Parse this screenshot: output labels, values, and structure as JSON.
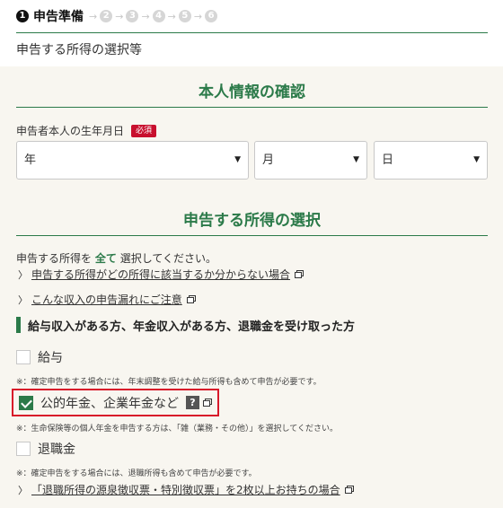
{
  "stepper": {
    "steps": [
      "1",
      "2",
      "3",
      "4",
      "5",
      "6"
    ],
    "active_label": "申告準備",
    "arrow": "→"
  },
  "subtitle": "申告する所得の選択等",
  "personal_section": {
    "heading": "本人情報の確認",
    "birth_label": "申告者本人の生年月日",
    "required_badge": "必須",
    "year_value": "年",
    "month_value": "月",
    "day_value": "日"
  },
  "income_section": {
    "heading": "申告する所得の選択",
    "intro_before": "申告する所得を",
    "intro_emphasis": "全て",
    "intro_after": "選択してください。",
    "link1": "申告する所得がどの所得に該当するか分からない場合",
    "link2": "こんな収入の申告漏れにご注意",
    "subheading": "給与収入がある方、年金収入がある方、退職金を受け取った方",
    "items": [
      {
        "label": "給与",
        "checked": false
      },
      {
        "label": "公的年金、企業年金など",
        "checked": true
      },
      {
        "label": "退職金",
        "checked": false
      }
    ],
    "note_salary": "※：確定申告をする場合には、年末調整を受けた給与所得も含めて申告が必要です。",
    "note_pension": "※：生命保険等の個人年金を申告する方は、「雑（業務・その他）」を選択してください。",
    "note_retire": "※：確定申告をする場合には、退職所得も含めて申告が必要です。",
    "link3": "「退職所得の源泉徴収票・特別徴収票」を2枚以上お持ちの場合",
    "help_glyph": "?"
  },
  "icons": {
    "caret": "▼",
    "chevron": "〉",
    "accent_color": "#2b7a49",
    "required_color": "#c8102e",
    "highlight_color": "#d8182a"
  }
}
